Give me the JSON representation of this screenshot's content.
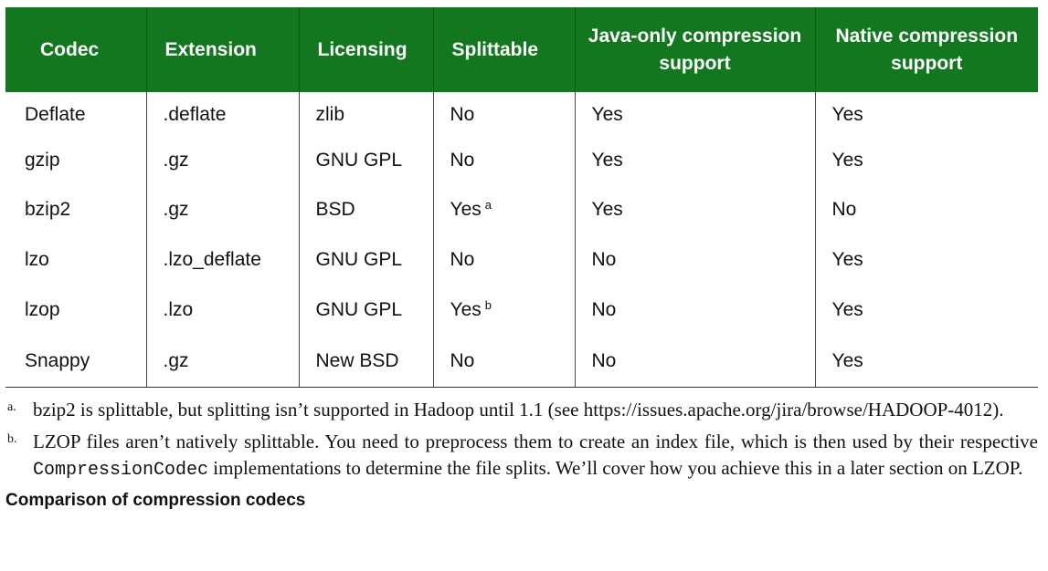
{
  "table": {
    "headers": [
      "Codec",
      "Extension",
      "Licensing",
      "Splittable",
      "Java-only compression support",
      "Native compression support"
    ],
    "rows": [
      [
        "Deflate",
        ".deflate",
        "zlib",
        "No",
        "Yes",
        "Yes"
      ],
      [
        "gzip",
        ".gz",
        "GNU GPL",
        "No",
        "Yes",
        "Yes"
      ],
      [
        "bzip2",
        ".gz",
        "BSD",
        "Yes",
        "Yes",
        "No"
      ],
      [
        "lzo",
        ".lzo_deflate",
        "GNU GPL",
        "No",
        "No",
        "Yes"
      ],
      [
        "lzop",
        ".lzo",
        "GNU GPL",
        "Yes",
        "No",
        "Yes"
      ],
      [
        "Snappy",
        ".gz",
        "New BSD",
        "No",
        "No",
        "Yes"
      ]
    ],
    "footnote_marks": {
      "bzip2": "a",
      "lzop": "b"
    },
    "header_colors": {
      "background": "#12771f",
      "text": "#ffffff"
    }
  },
  "footnotes": {
    "a": {
      "label": "a.",
      "text": "bzip2 is splittable, but splitting isn’t supported in Hadoop until 1.1 (see https://issues.apache.org/jira/browse/HADOOP-4012)."
    },
    "b": {
      "label": "b.",
      "text_before": "LZOP files aren’t natively splittable. You need to preprocess them to create an index file, which is then used by their respective ",
      "code": "CompressionCodec",
      "text_after": " implementations to determine the file splits. We’ll cover how you achieve this in a later section on LZOP."
    }
  },
  "caption": "Comparison of compression codecs"
}
